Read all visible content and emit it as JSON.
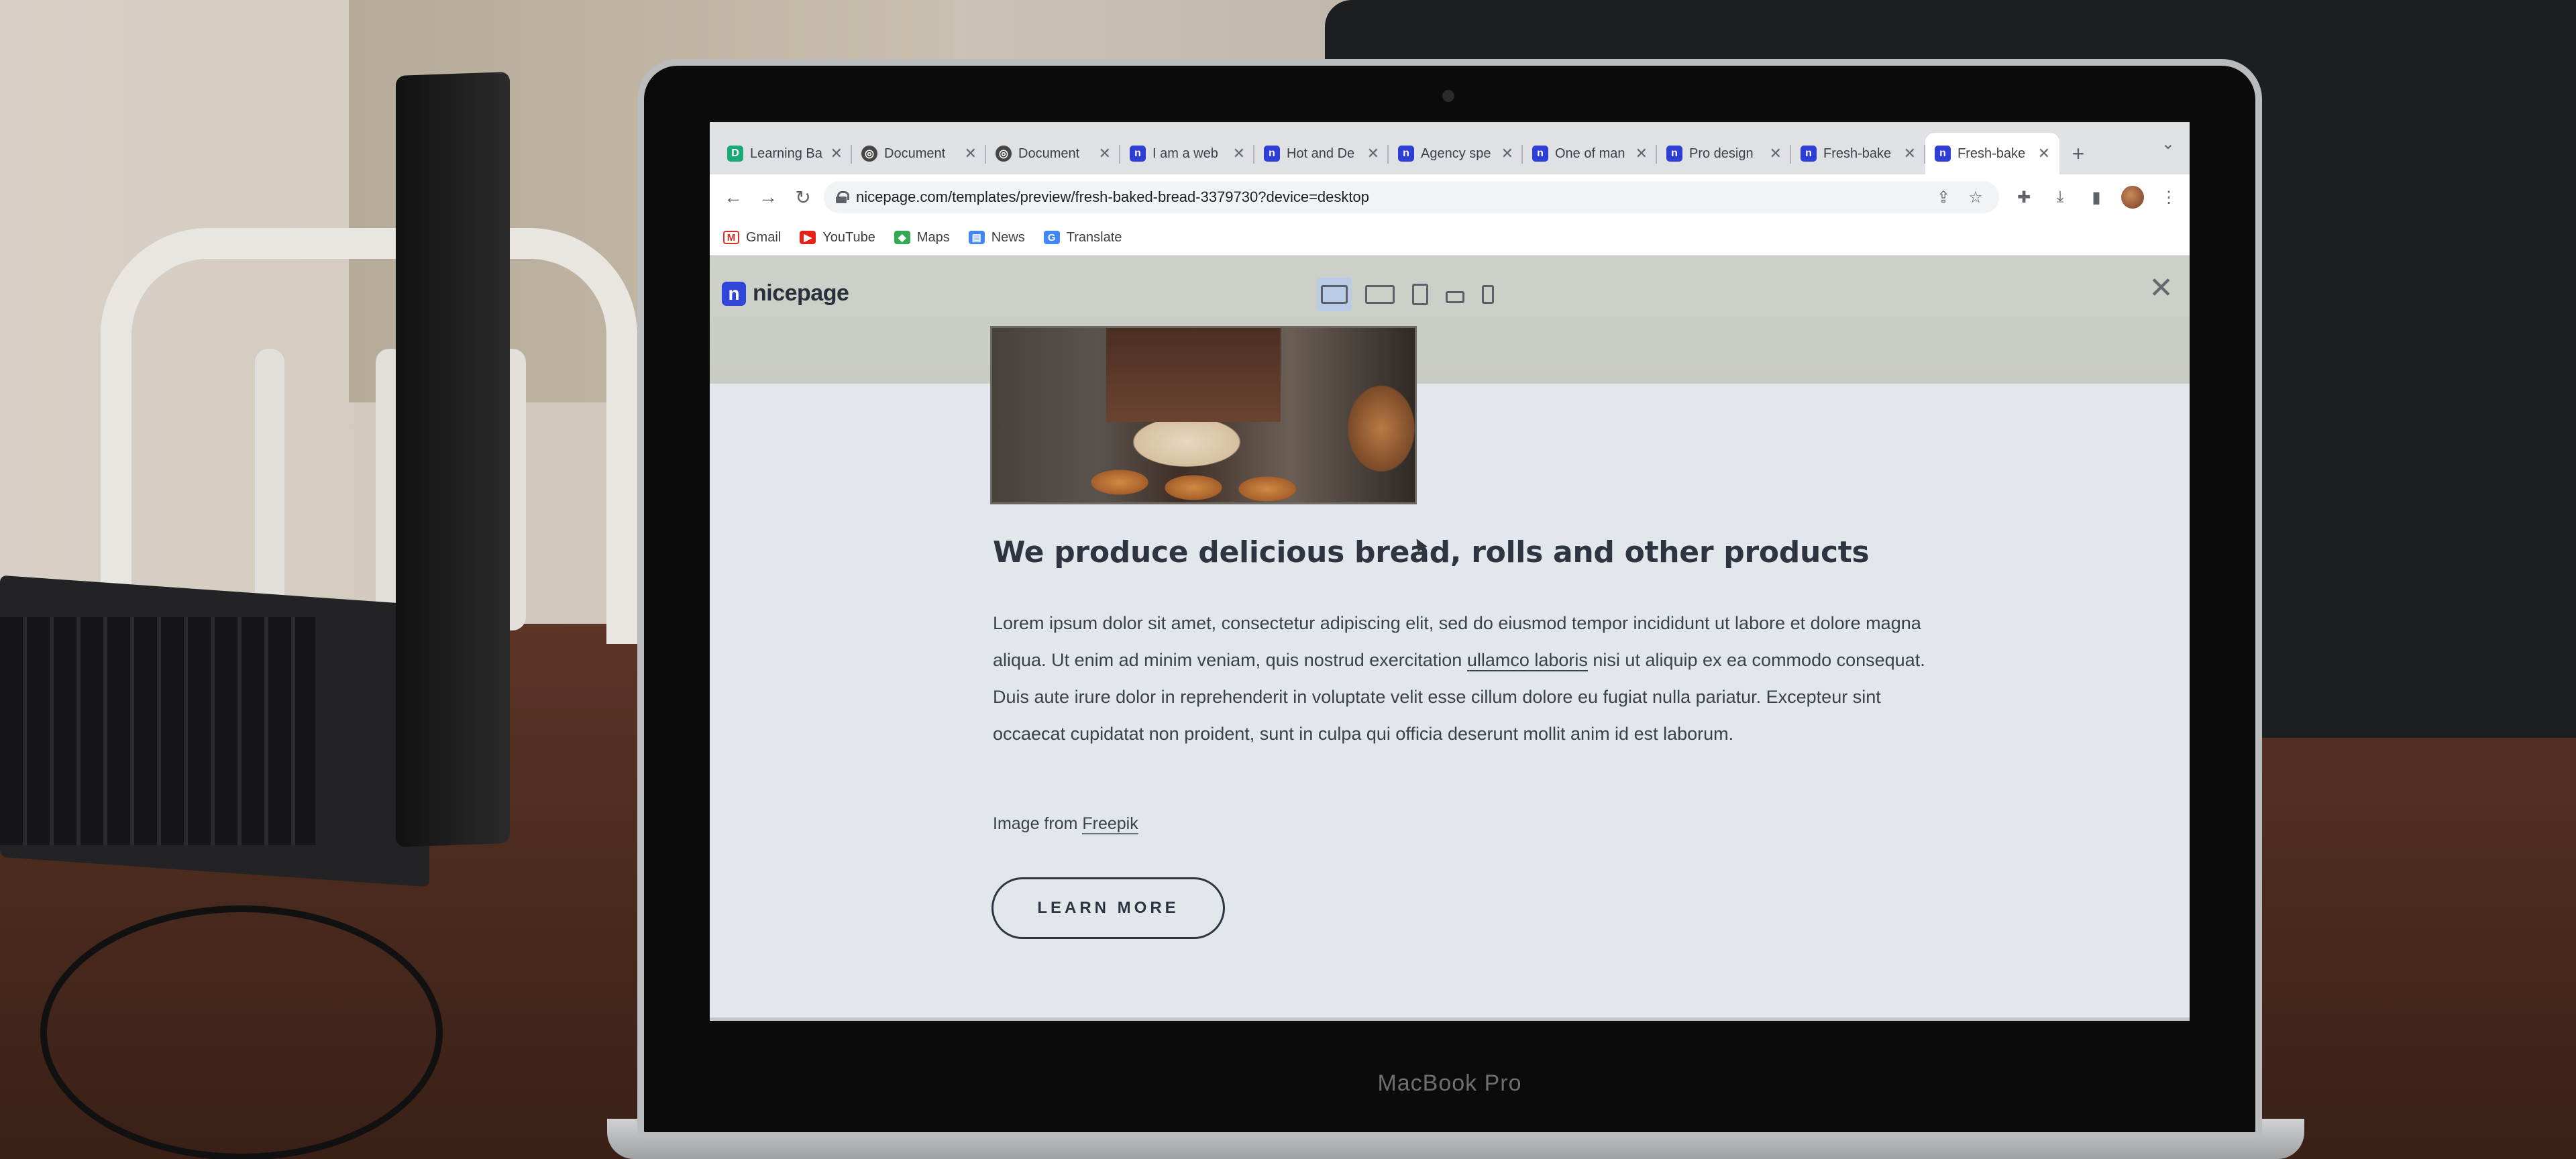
{
  "browser": {
    "tabs": [
      {
        "icon": "learning-favicon",
        "title": "Learning Ba"
      },
      {
        "icon": "document-favicon",
        "title": "Document"
      },
      {
        "icon": "document-favicon",
        "title": "Document"
      },
      {
        "icon": "nicepage-favicon",
        "title": "I am a web"
      },
      {
        "icon": "nicepage-favicon",
        "title": "Hot and De"
      },
      {
        "icon": "nicepage-favicon",
        "title": "Agency spe"
      },
      {
        "icon": "nicepage-favicon",
        "title": "One of man"
      },
      {
        "icon": "nicepage-favicon",
        "title": "Pro design"
      },
      {
        "icon": "nicepage-favicon",
        "title": "Fresh-bake"
      },
      {
        "icon": "nicepage-favicon",
        "title": "Fresh-bake"
      }
    ],
    "active_tab_index": 9,
    "url": "nicepage.com/templates/preview/fresh-baked-bread-3379730?device=desktop",
    "bookmarks": [
      {
        "icon": "gmail-icon",
        "label": "Gmail"
      },
      {
        "icon": "youtube-icon",
        "label": "YouTube"
      },
      {
        "icon": "maps-icon",
        "label": "Maps"
      },
      {
        "icon": "news-icon",
        "label": "News"
      },
      {
        "icon": "translate-icon",
        "label": "Translate"
      }
    ]
  },
  "preview": {
    "logo_text": "nicepage",
    "devices": [
      "desktop",
      "laptop",
      "tablet",
      "phone-landscape",
      "phone-portrait"
    ],
    "active_device": "desktop"
  },
  "content": {
    "headline": "We produce delicious bread, rolls and other products",
    "body_before": "Lorem ipsum dolor sit amet, consectetur adipiscing elit, sed do eiusmod tempor incididunt ut labore et dolore magna aliqua. Ut enim ad minim veniam, quis nostrud exercitation ",
    "body_link": "ullamco laboris",
    "body_after": " nisi ut aliquip ex ea commodo consequat. Duis aute irure dolor in reprehenderit in voluptate velit esse cillum dolore eu fugiat nulla pariatur. Excepteur sint occaecat cupidatat non proident, sunt in culpa qui officia deserunt mollit anim id est laborum.",
    "credit_prefix": "Image from ",
    "credit_link": "Freepik",
    "button_label": "LEARN MORE"
  },
  "hardware": {
    "laptop_label": "MacBook Pro"
  },
  "colors": {
    "nicepage_brand": "#2f46d8",
    "page_background": "#e3e6ea",
    "text_dark": "#2e3440"
  }
}
